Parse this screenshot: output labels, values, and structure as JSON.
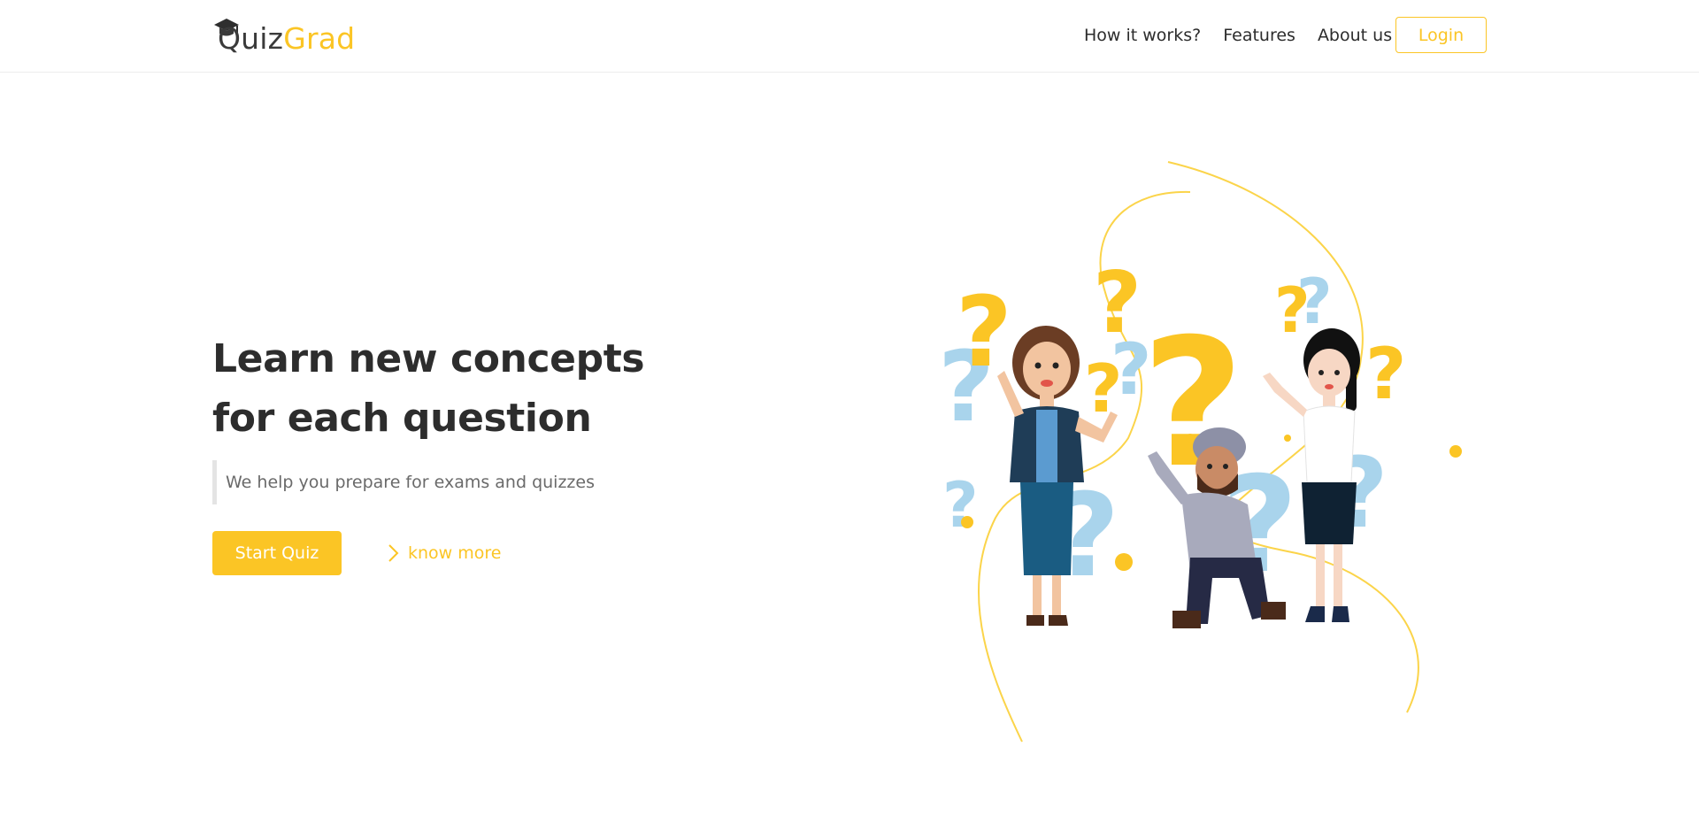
{
  "brand": {
    "part1": "Quiz",
    "part2": "Grad",
    "icon": "graduation-cap-icon",
    "accent": "#fbc525"
  },
  "nav": {
    "links": [
      "How it works?",
      "Features",
      "About us"
    ],
    "login_label": "Login"
  },
  "hero": {
    "title": "Learn new concepts for each question",
    "subtitle": "We help you prepare for exams and quizzes",
    "primary_label": "Start Quiz",
    "secondary_label": "know more",
    "secondary_icon": "chevron-right-icon",
    "illustration": "people-with-question-marks-illustration"
  }
}
